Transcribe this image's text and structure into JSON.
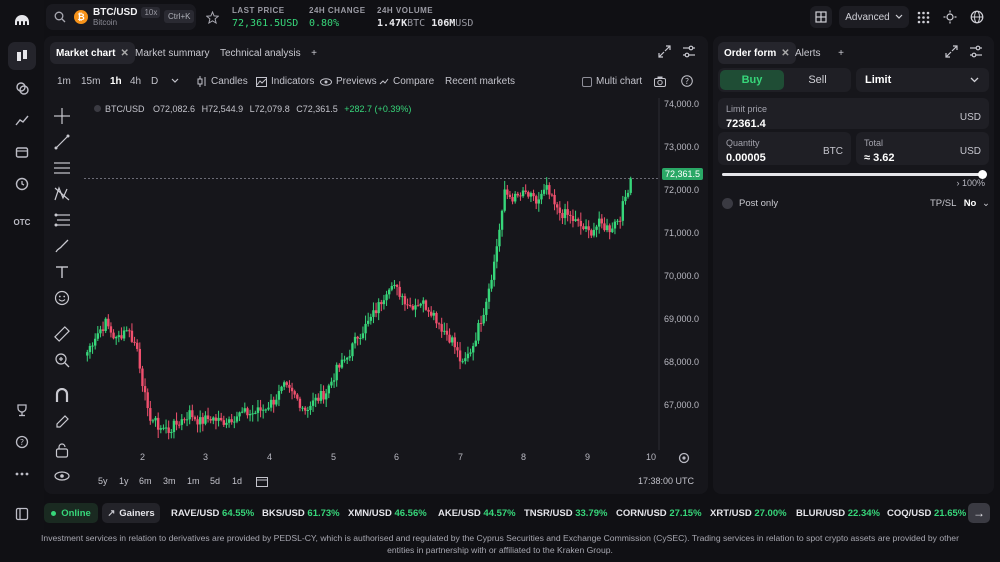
{
  "header": {
    "pair": "BTC/USD",
    "coin_name": "Bitcoin",
    "leverage": "10x",
    "shortcut": "Ctrl+K",
    "stats": [
      {
        "label": "LAST PRICE",
        "value": "72,361.5",
        "unit": "USD"
      },
      {
        "label": "24H CHANGE",
        "value": "0.80%"
      },
      {
        "label": "24H VOLUME",
        "value": "1.47K",
        "unit1": "BTC",
        "value2": "106M",
        "unit2": "USD"
      }
    ],
    "mode_button": "Advanced"
  },
  "chart_panel": {
    "tabs": [
      "Market chart",
      "Market summary",
      "Technical analysis"
    ],
    "timeframes": [
      "1m",
      "15m",
      "1h",
      "4h",
      "D"
    ],
    "active_timeframe": "1h",
    "toolbar": {
      "candles": "Candles",
      "indicators": "Indicators",
      "previews": "Previews",
      "compare": "Compare",
      "recent": "Recent markets",
      "multi": "Multi chart"
    },
    "ohlc": {
      "symbol": "BTC/USD",
      "o": "O72,082.6",
      "h": "H72,544.9",
      "l": "L72,079.8",
      "c": "C72,361.5",
      "chg": "+282.7 (+0.39%)"
    },
    "y_ticks": [
      "74,000.0",
      "73,000.0",
      "72,000.0",
      "71,000.0",
      "70,000.0",
      "69,000.0",
      "68,000.0",
      "67,000.0"
    ],
    "price_tag": "72,361.5",
    "x_ticks": [
      "2",
      "3",
      "4",
      "5",
      "6",
      "7",
      "8",
      "9",
      "10"
    ],
    "ranges": [
      "5y",
      "1y",
      "6m",
      "3m",
      "1m",
      "5d",
      "1d"
    ],
    "clock": "17:38:00 UTC"
  },
  "chart_data": {
    "type": "candlestick",
    "symbol": "BTC/USD",
    "interval": "1h",
    "ylim": [
      66000,
      74000
    ],
    "y_ticks": [
      74000,
      73000,
      72000,
      71000,
      70000,
      69000,
      68000,
      67000
    ],
    "x_ticks": [
      "2",
      "3",
      "4",
      "5",
      "6",
      "7",
      "8",
      "9",
      "10"
    ],
    "last_price": 72361.5,
    "closes": [
      68200,
      68700,
      69000,
      68600,
      68900,
      68400,
      66900,
      66600,
      66500,
      66700,
      66900,
      66700,
      66800,
      66700,
      66800,
      66900,
      66900,
      67000,
      67200,
      67500,
      67300,
      67000,
      67200,
      67400,
      67900,
      68200,
      68700,
      69000,
      69400,
      69900,
      69700,
      69400,
      69500,
      69300,
      68900,
      68600,
      68000,
      68500,
      69300,
      70400,
      72000,
      71900,
      72000,
      71800,
      72100,
      71600,
      71500,
      71300,
      71100,
      71300,
      71200,
      71500,
      72361.5
    ],
    "colors": {
      "up": "#37d67a",
      "down": "#f0506e"
    }
  },
  "order_form": {
    "tabs": [
      "Order form",
      "Alerts"
    ],
    "buy": "Buy",
    "sell": "Sell",
    "type": "Limit",
    "limit_label": "Limit price",
    "limit_value": "72361.4",
    "limit_unit": "USD",
    "qty_label": "Quantity",
    "qty_value": "0.00005",
    "qty_unit": "BTC",
    "total_label": "Total",
    "total_value": "≈  3.62",
    "total_unit": "USD",
    "slider_pct": "100%",
    "slider_value": 1.0,
    "post_only": "Post only",
    "tpsl_label": "TP/SL",
    "tpsl_value": "No"
  },
  "ticker": {
    "status": "Online",
    "gainers": "Gainers",
    "items": [
      {
        "sym": "RAVE/USD",
        "pct": "64.55%"
      },
      {
        "sym": "BKS/USD",
        "pct": "61.73%"
      },
      {
        "sym": "XMN/USD",
        "pct": "46.56%"
      },
      {
        "sym": "AKE/USD",
        "pct": "44.57%"
      },
      {
        "sym": "TNSR/USD",
        "pct": "33.79%"
      },
      {
        "sym": "CORN/USD",
        "pct": "27.15%"
      },
      {
        "sym": "XRT/USD",
        "pct": "27.00%"
      },
      {
        "sym": "BLUR/USD",
        "pct": "22.34%"
      },
      {
        "sym": "COQ/USD",
        "pct": "21.65%"
      }
    ]
  },
  "disclaimer": "Investment services in relation to derivatives are provided by PEDSL-CY, which is authorised and regulated by the Cyprus Securities and Exchange Commission (CySEC). Trading services in relation to spot crypto assets are provided by other entities in partnership with or affiliated to the Kraken Group.",
  "colors": {
    "accent_green": "#37d67a",
    "down_red": "#f0506e",
    "background": "#101014"
  }
}
